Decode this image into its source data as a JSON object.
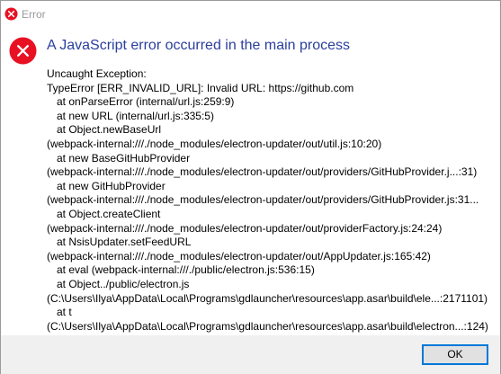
{
  "window": {
    "title": "Error"
  },
  "dialog": {
    "heading": "A JavaScript error occurred in the main process",
    "message_lines": [
      {
        "text": "Uncaught Exception:",
        "indent": false
      },
      {
        "text": "TypeError [ERR_INVALID_URL]: Invalid URL: https://github.com",
        "indent": false
      },
      {
        "text": "at onParseError (internal/url.js:259:9)",
        "indent": true
      },
      {
        "text": "at new URL (internal/url.js:335:5)",
        "indent": true
      },
      {
        "text": "at Object.newBaseUrl",
        "indent": true
      },
      {
        "text": "(webpack-internal:///./node_modules/electron-updater/out/util.js:10:20)",
        "indent": false
      },
      {
        "text": "at new BaseGitHubProvider",
        "indent": true
      },
      {
        "text": "(webpack-internal:///./node_modules/electron-updater/out/providers/GitHubProvider.j...:31)",
        "indent": false
      },
      {
        "text": "at new GitHubProvider",
        "indent": true
      },
      {
        "text": "(webpack-internal:///./node_modules/electron-updater/out/providers/GitHubProvider.js:31...",
        "indent": false
      },
      {
        "text": "at Object.createClient",
        "indent": true
      },
      {
        "text": "(webpack-internal:///./node_modules/electron-updater/out/providerFactory.js:24:24)",
        "indent": false
      },
      {
        "text": "at NsisUpdater.setFeedURL",
        "indent": true
      },
      {
        "text": "(webpack-internal:///./node_modules/electron-updater/out/AppUpdater.js:165:42)",
        "indent": false
      },
      {
        "text": "at eval (webpack-internal:///./public/electron.js:536:15)",
        "indent": true
      },
      {
        "text": "at Object../public/electron.js",
        "indent": true
      },
      {
        "text": "(C:\\Users\\Ilya\\AppData\\Local\\Programs\\gdlauncher\\resources\\app.asar\\build\\ele...:2171101)",
        "indent": false
      },
      {
        "text": "at t",
        "indent": true
      },
      {
        "text": "(C:\\Users\\Ilya\\AppData\\Local\\Programs\\gdlauncher\\resources\\app.asar\\build\\electron...:124)",
        "indent": false
      }
    ]
  },
  "footer": {
    "ok_label": "OK"
  },
  "colors": {
    "error_red": "#e81123",
    "heading_blue": "#2a3f9d",
    "button_border": "#0078d7",
    "footer_bg": "#f0f0f0"
  },
  "icons": {
    "title": "error-icon",
    "main": "error-icon"
  }
}
